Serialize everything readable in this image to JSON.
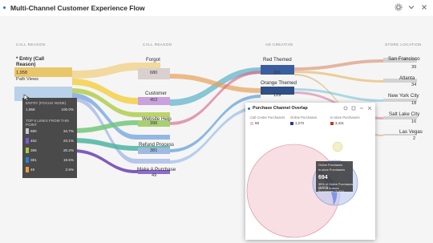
{
  "header": {
    "title": "Multi-Channel Customer Experience Flow"
  },
  "columns": [
    "CALL REASON",
    "CALL REASON",
    "AD CREATIVE",
    "STORE LOCATION"
  ],
  "entry": {
    "label_line1": "* Entry (Call",
    "label_line2": "Reason)",
    "value": "1,958",
    "sublabel": "Path Views"
  },
  "call_nodes": [
    {
      "label": "Forgot",
      "value": "680"
    },
    {
      "label": "Customer",
      "value": "452"
    },
    {
      "label": "Website Help",
      "value": "396"
    },
    {
      "label": "Refund Process",
      "value": "381"
    },
    {
      "label": "Make A Purchase",
      "value": "49"
    }
  ],
  "ad_nodes": [
    {
      "label": "Red Themed",
      "value": "161"
    },
    {
      "label": "Orange Themed",
      "value": "129"
    }
  ],
  "store_nodes": [
    {
      "label": "San Francisco",
      "value": "39"
    },
    {
      "label": "Atlanta",
      "value": "34"
    },
    {
      "label": "New York City",
      "value": "18"
    },
    {
      "label": "Salt Lake City",
      "value": "16"
    },
    {
      "label": "Las Vegas",
      "value": "2"
    }
  ],
  "tooltip": {
    "header": "ENTRY (FOCUS NODE)",
    "focus_value": "1,958",
    "focus_pct": "100.0%",
    "section": "TOP 5 LINKS FROM THIS POINT",
    "rows": [
      {
        "value": "680",
        "pct": "34.7%",
        "color": "#c7c7c7"
      },
      {
        "value": "452",
        "pct": "23.1%",
        "color": "#7a5ad9"
      },
      {
        "value": "396",
        "pct": "20.2%",
        "color": "#a8c93f"
      },
      {
        "value": "381",
        "pct": "19.5%",
        "color": "#2f7ed8"
      },
      {
        "value": "49",
        "pct": "2.5%",
        "color": "#e9a23b"
      }
    ]
  },
  "popup": {
    "title": "Purchase Channel Overlap",
    "legend": [
      {
        "label": "Call Center Purchasers",
        "value": "68",
        "color": "#f2c6cf"
      },
      {
        "label": "Online Purchases",
        "value": "1,273",
        "color": "#2b3b8f"
      },
      {
        "label": "In-store Purchasers",
        "value": "3,421",
        "color": "#c0392b"
      }
    ],
    "venn_tip": {
      "line1": "Online Purchases",
      "line2": "In-store Purchasers",
      "value": "694",
      "line3": "55% of Online Purchases (1,273)",
      "line4": "19% of In-store Purchasers (3,421)"
    }
  },
  "colors": {
    "accent": "#1473e6"
  }
}
